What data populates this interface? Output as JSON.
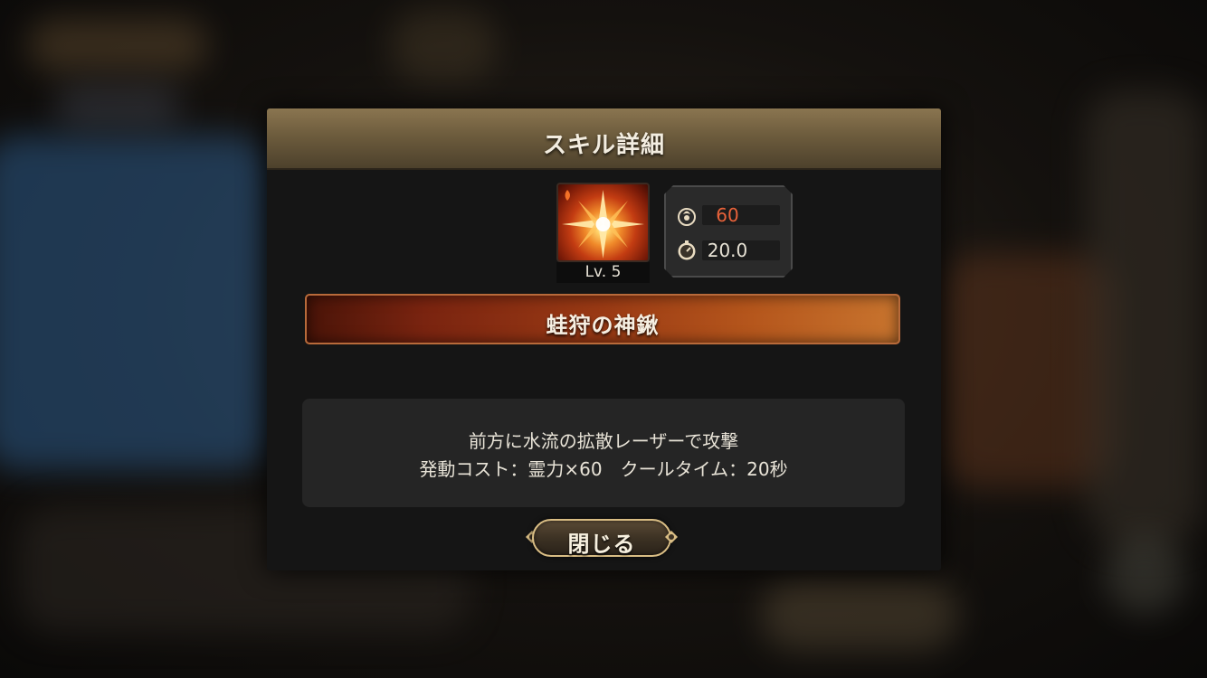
{
  "dialog": {
    "title": "スキル詳細"
  },
  "skill": {
    "level_label": "Lv. 5",
    "name": "蛙狩の神鍬",
    "icon": "fire-burst-icon"
  },
  "stats": {
    "cost_icon": "spirit-power-icon",
    "cost_value": "60",
    "cooldown_icon": "stopwatch-icon",
    "cooldown_value": "20.0"
  },
  "description": {
    "line1": "前方に水流の拡散レーザーで攻撃",
    "line2": "発動コスト：霊力×60　クールタイム：20秒"
  },
  "buttons": {
    "close_label": "閉じる"
  },
  "colors": {
    "cost_accent": "#e8623a",
    "header_gold": "#8a7550",
    "button_border": "#d9bd84"
  }
}
